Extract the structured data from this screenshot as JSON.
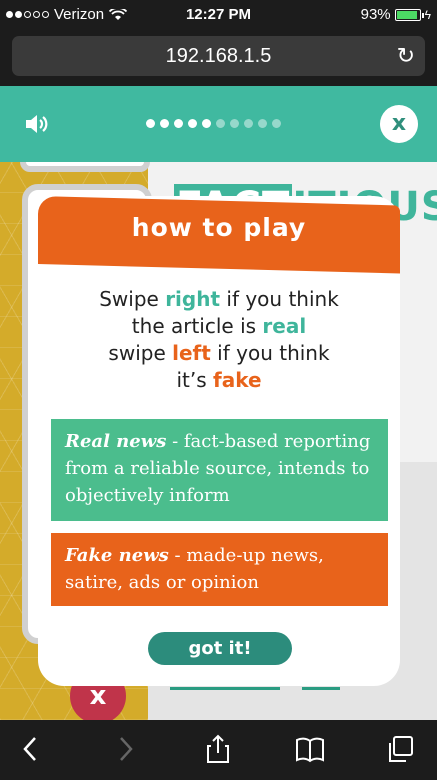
{
  "status_bar": {
    "carrier": "Verizon",
    "time": "12:27 PM",
    "battery": "93%",
    "battery_level": 0.93
  },
  "browser": {
    "url": "192.168.1.5",
    "reload_icon": "reload-icon"
  },
  "game_header": {
    "sound_icon": "speaker-icon",
    "progress": {
      "filled": 5,
      "total": 10
    },
    "close_label": "x"
  },
  "background": {
    "logo_text_highlight": "FACT",
    "logo_text_rest": "ITIOUS",
    "reject_label": "x"
  },
  "modal": {
    "title": "how to play",
    "line1_pre": "Swipe ",
    "line1_key": "right",
    "line1_post": " if you think",
    "line2_pre": "the article is ",
    "line2_key": "real",
    "line3_pre": "swipe ",
    "line3_key": "left",
    "line3_post": " if you think",
    "line4_pre": "it’s ",
    "line4_key": "fake",
    "real_term": "Real news",
    "real_desc": " - fact-based reporting from a reliable source, intends to objectively inform",
    "fake_term": "Fake news",
    "fake_desc": " - made-up news, satire, ads or opinion",
    "button": "got it!"
  },
  "colors": {
    "teal": "#40b9a0",
    "orange": "#e8631b",
    "green": "#4bbd8d",
    "dark_teal": "#2c8c7c",
    "mustard": "#d4ab2a"
  }
}
